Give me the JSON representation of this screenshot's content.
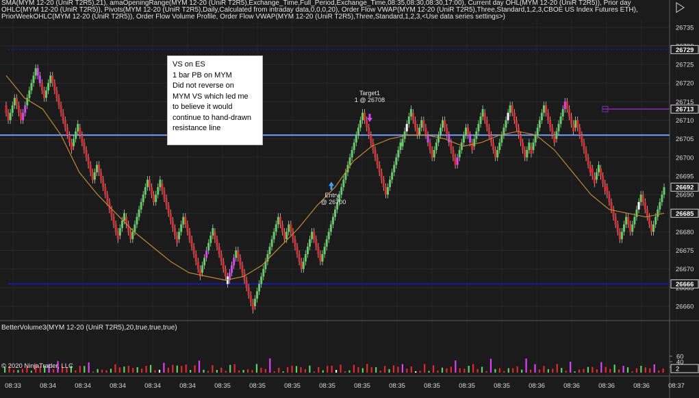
{
  "header_text": "SMA(MYM 12-20 (UniR T2R5),21), amaOpeningRange(MYM 12-20 (UniR T2R5),Exchange_Time,Full_Period,Exchange_Time,08:35,08:30,08:30,17:00), Current day OHL(MYM 12-20 (UniR T2R5)), Prior day OHLC(MYM 12-20 (UniR T2R5)), Pivots(MYM 12-20 (UniR T2R5),Daily,Calculated from intraday data,0,0,0,20), Order Flow VWAP(MYM 12-20 (UniR T2R5),Three,Standard,1,2,3,CBOE US Index Futures ETH), PriorWeekOHLC(MYM 12-20 (UniR T2R5)), Order Flow Volume Profile, Order Flow VWAP(MYM 12-20 (UniR T2R5),Three,Standard,1,2,3,<Use data series settings>)",
  "annotation_lines": [
    "VS on ES",
    "1 bar PB  on MYM",
    "Did not reverse  on",
    "MYM VS which led me",
    "to believe it would",
    "continue  to hand-drawn",
    "resistance line"
  ],
  "target_label_1": "Target1",
  "target_label_2": "1 @ 26708",
  "entry_label_1": "Entry",
  "entry_label_2": "@ 26700",
  "indicator_title": "BetterVolume3(MYM 12-20 (UniR T2R5),20,true,true,true)",
  "copyright": "© 2020 NinjaTrader, LLC",
  "colors": {
    "up": "#59d45c",
    "down": "#e8262b",
    "climax": "#e040fb",
    "churn": "#ffffff",
    "sma": "#c8892a",
    "pivot": "#6fa0ff",
    "opening_range": "#1818b0",
    "prior": "#8a2bb0"
  },
  "chart_data": [
    {
      "type": "candlestick",
      "instrument": "MYM 12-20 (UniR T2R5)",
      "y_axis_ticks": [
        26660,
        26665,
        26670,
        26675,
        26680,
        26685,
        26690,
        26695,
        26700,
        26705,
        26710,
        26715,
        26720,
        26725,
        26730,
        26735
      ],
      "ylim": [
        26656.5,
        26741
      ],
      "x_tick_labels": [
        "08:33",
        "08:34",
        "08:34",
        "08:34",
        "08:34",
        "08:34",
        "08:35",
        "08:35",
        "08:35",
        "08:35",
        "08:35",
        "08:35",
        "08:35",
        "08:35",
        "08:35",
        "08:36",
        "08:36",
        "08:36",
        "08:36",
        "08:37",
        "08:37"
      ],
      "price_labels": [
        26729,
        26713,
        26692,
        26685,
        26666
      ],
      "horizontal_lines": [
        {
          "name": "pivot",
          "value": 26706
        },
        {
          "name": "opening-range-high",
          "value": 26729
        },
        {
          "name": "opening-range-low",
          "value": 26666
        },
        {
          "name": "prior-level",
          "value": 26713
        }
      ],
      "path": [
        26714,
        26710,
        26716,
        26710,
        26724,
        26716,
        26722,
        26703,
        26708,
        26694,
        26698,
        26679,
        26684,
        26678,
        26694,
        26688,
        26693,
        26678,
        26684,
        26669,
        26680,
        26667,
        26675,
        26660,
        26670,
        26680,
        26684,
        26678,
        26682,
        26670,
        26680,
        26672,
        26698,
        26712,
        26710,
        26690,
        26694,
        26703,
        26712,
        26706,
        26710,
        26700,
        26710,
        26698,
        26708,
        26703,
        26712,
        26700,
        26714,
        26704,
        26700,
        26703,
        26702,
        26714,
        26705,
        26715,
        26708,
        26710,
        26697,
        26694,
        26697,
        26692,
        26684,
        26678,
        26684,
        26680,
        26690,
        26680,
        26692
      ],
      "sma_path": [
        26722,
        26716,
        26713,
        26706,
        26696,
        26690,
        26685,
        26680,
        26676,
        26672,
        26669,
        26668,
        26667,
        26668,
        26671,
        26676,
        26681,
        26687,
        26692,
        26699,
        26703,
        26705,
        26706,
        26706,
        26705,
        26703,
        26704,
        26706,
        26707,
        26706,
        26702,
        26696,
        26690,
        26686,
        26685,
        26684,
        26685
      ],
      "volume_ylim": [
        0,
        72
      ],
      "volume_ticks": [
        20,
        40,
        60
      ],
      "volume_last": 2
    }
  ]
}
